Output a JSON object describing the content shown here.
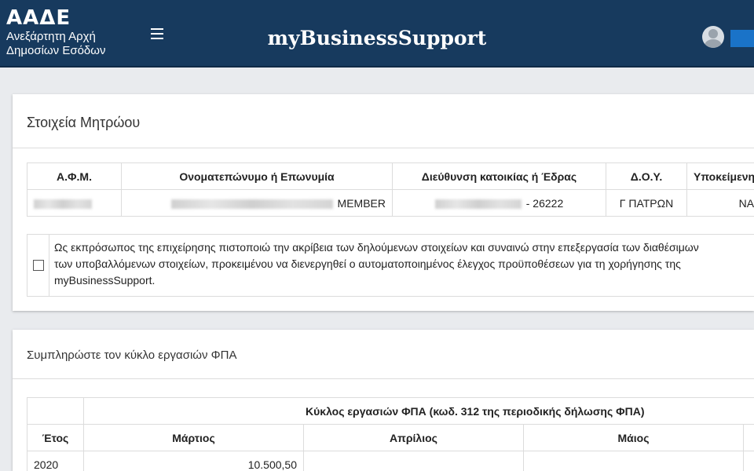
{
  "header": {
    "logo_title": "ΑΑΔΕ",
    "logo_line1": "Ανεξάρτητη Αρχή",
    "logo_line2": "Δημοσίων Εσόδων",
    "menu_icon": "hamburger-menu-icon",
    "app_title": "myBusinessSupport",
    "avatar_icon": "user-avatar-icon",
    "colors": {
      "bar": "#173a5e",
      "accent": "#1a73c8"
    }
  },
  "registry": {
    "title": "Στοιχεία Μητρώου",
    "columns": [
      "Α.Φ.Μ.",
      "Ονοματεπώνυμο ή Επωνυμία",
      "Διεύθυνση κατοικίας ή Έδρας",
      "Δ.Ο.Υ.",
      "Υποκείμενη"
    ],
    "row": {
      "name_suffix": "MEMBER",
      "address_suffix": "- 26222",
      "tax_office": "Γ ΠΑΤΡΩΝ",
      "subject": "ΝΑΙ"
    }
  },
  "consent": {
    "line1": "Ως εκπρόσωπος της επιχείρησης πιστοποιώ την ακρίβεια των δηλούμενων στοιχείων και συναινώ στην επεξεργασία των διαθέσιμων",
    "line2": "των υποβαλλόμενων στοιχείων, προκειμένου να διενεργηθεί ο αυτοματοποιημένος έλεγχος προϋποθέσεων για τη χορήγησης της",
    "line3": "myBusinessSupport."
  },
  "vat": {
    "title": "Συμπληρώστε τον κύκλο εργασιών ΦΠΑ",
    "group_header": "Κύκλος εργασιών ΦΠΑ (κωδ. 312 της περιοδικής δήλωσης ΦΠΑ)",
    "columns": [
      "Έτος",
      "Μάρτιος",
      "Απρίλιος",
      "Μάιος"
    ],
    "rows": [
      {
        "year": "2020",
        "march": "10.500,50",
        "april": "",
        "may": ""
      }
    ]
  }
}
